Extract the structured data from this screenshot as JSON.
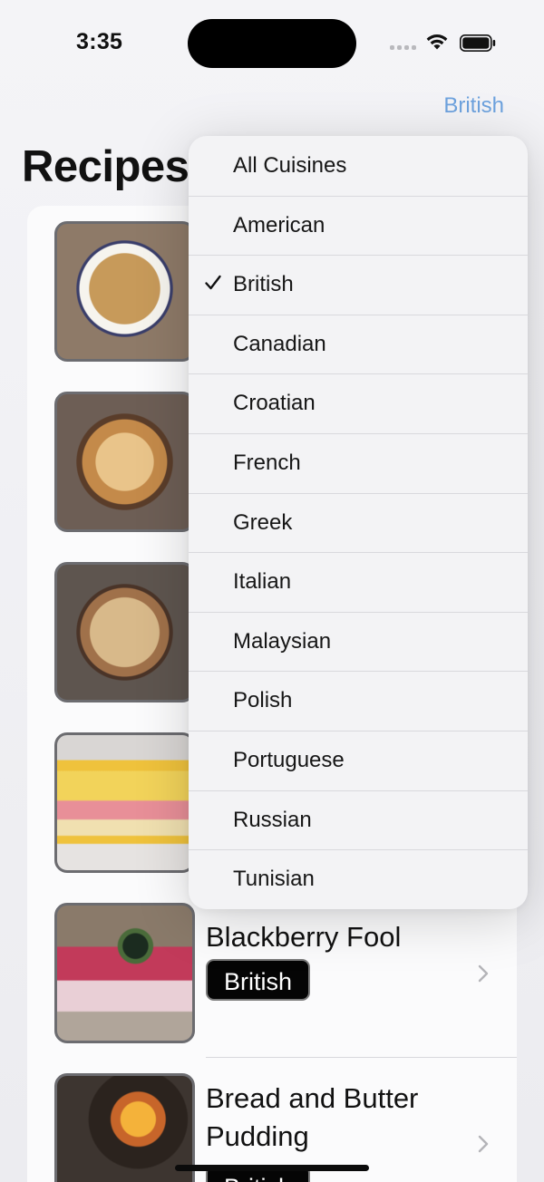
{
  "status_bar": {
    "time": "3:35"
  },
  "nav": {
    "filter_label": "British",
    "title": "Recipes"
  },
  "recipes": [
    {
      "title": "",
      "badge": ""
    },
    {
      "title": "",
      "badge": ""
    },
    {
      "title": "",
      "badge": ""
    },
    {
      "title": "",
      "badge": ""
    },
    {
      "title": "Blackberry Fool",
      "badge": "British"
    },
    {
      "title": "Bread and Butter Pudding",
      "badge": "British"
    }
  ],
  "cuisine_menu": {
    "selected": "British",
    "items": [
      "All Cuisines",
      "American",
      "British",
      "Canadian",
      "Croatian",
      "French",
      "Greek",
      "Italian",
      "Malaysian",
      "Polish",
      "Portuguese",
      "Russian",
      "Tunisian"
    ]
  },
  "colors": {
    "accent": "#6da2de",
    "badge_bg": "#050505"
  }
}
